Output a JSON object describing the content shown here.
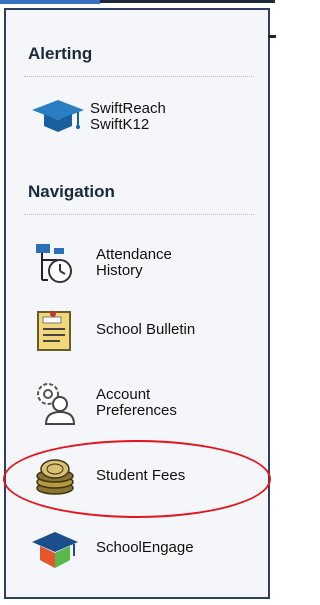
{
  "sections": {
    "alerting": {
      "heading": "Alerting",
      "items": [
        {
          "label": "SwiftReach\nSwiftK12",
          "icon": "graduation-cap-icon"
        }
      ]
    },
    "navigation": {
      "heading": "Navigation",
      "items": [
        {
          "label": "Attendance\nHistory",
          "icon": "attendance-clock-icon"
        },
        {
          "label": "School Bulletin",
          "icon": "bulletin-icon"
        },
        {
          "label": "Account\nPreferences",
          "icon": "account-gear-icon"
        },
        {
          "label": "Student Fees",
          "icon": "coins-icon"
        },
        {
          "label": "SchoolEngage",
          "icon": "schoolengage-cap-icon"
        }
      ]
    }
  },
  "highlight_color": "#e4141b"
}
